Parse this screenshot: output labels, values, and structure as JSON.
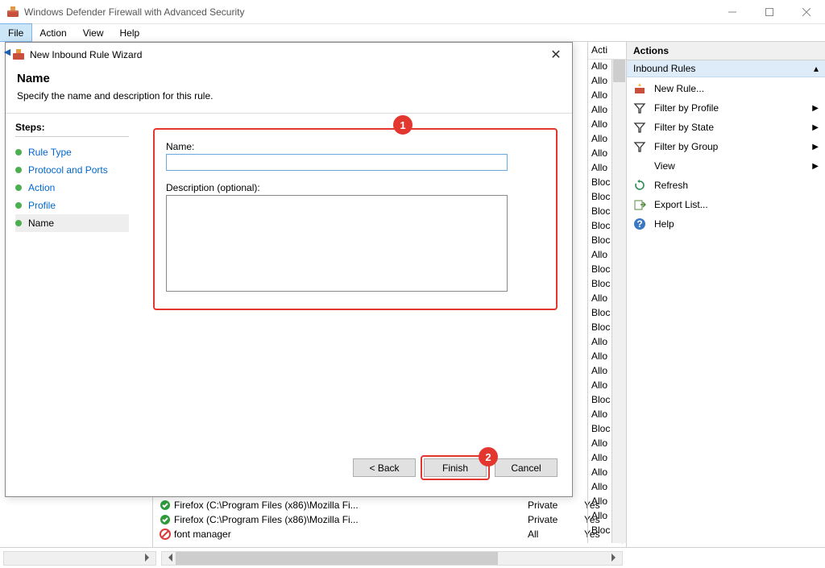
{
  "titlebar": {
    "title": "Windows Defender Firewall with Advanced Security"
  },
  "menu": {
    "file": "File",
    "action": "Action",
    "view": "View",
    "help": "Help"
  },
  "wizard": {
    "title": "New Inbound Rule Wizard",
    "heading": "Name",
    "subheading": "Specify the name and description for this rule.",
    "steps_label": "Steps:",
    "steps": [
      {
        "label": "Rule Type"
      },
      {
        "label": "Protocol and Ports"
      },
      {
        "label": "Action"
      },
      {
        "label": "Profile"
      },
      {
        "label": "Name"
      }
    ],
    "name_label": "Name:",
    "name_value": "",
    "desc_label": "Description (optional):",
    "desc_value": "",
    "buttons": {
      "back": "< Back",
      "finish": "Finish",
      "cancel": "Cancel"
    },
    "callouts": {
      "one": "1",
      "two": "2"
    }
  },
  "rules_header": "Acti",
  "rules": [
    "Allo",
    "Allo",
    "Allo",
    "Allo",
    "Allo",
    "Allo",
    "Allo",
    "Allo",
    "Bloc",
    "Bloc",
    "Bloc",
    "Bloc",
    "Bloc",
    "Allo",
    "Bloc",
    "Bloc",
    "Allo",
    "Bloc",
    "Bloc",
    "Allo",
    "Allo",
    "Allo",
    "Allo",
    "Bloc",
    "Allo",
    "Bloc",
    "Allo",
    "Allo",
    "Allo",
    "Allo",
    "Allo",
    "Allo",
    "Bloc"
  ],
  "lower_rows": [
    {
      "icon": "allow",
      "name": "Firefox (C:\\Program Files (x86)\\Mozilla Fi...",
      "profile": "Private",
      "enabled": "Yes"
    },
    {
      "icon": "allow",
      "name": "Firefox (C:\\Program Files (x86)\\Mozilla Fi...",
      "profile": "Private",
      "enabled": "Yes"
    },
    {
      "icon": "block",
      "name": "font manager",
      "profile": "All",
      "enabled": "Yes"
    }
  ],
  "actions": {
    "title": "Actions",
    "section": "Inbound Rules",
    "items": [
      {
        "icon": "newrule",
        "label": "New Rule...",
        "arrow": false
      },
      {
        "icon": "filter",
        "label": "Filter by Profile",
        "arrow": true
      },
      {
        "icon": "filter",
        "label": "Filter by State",
        "arrow": true
      },
      {
        "icon": "filter",
        "label": "Filter by Group",
        "arrow": true
      },
      {
        "icon": "none",
        "label": "View",
        "arrow": true
      },
      {
        "icon": "refresh",
        "label": "Refresh",
        "arrow": false
      },
      {
        "icon": "export",
        "label": "Export List...",
        "arrow": false
      },
      {
        "icon": "help",
        "label": "Help",
        "arrow": false
      }
    ]
  }
}
